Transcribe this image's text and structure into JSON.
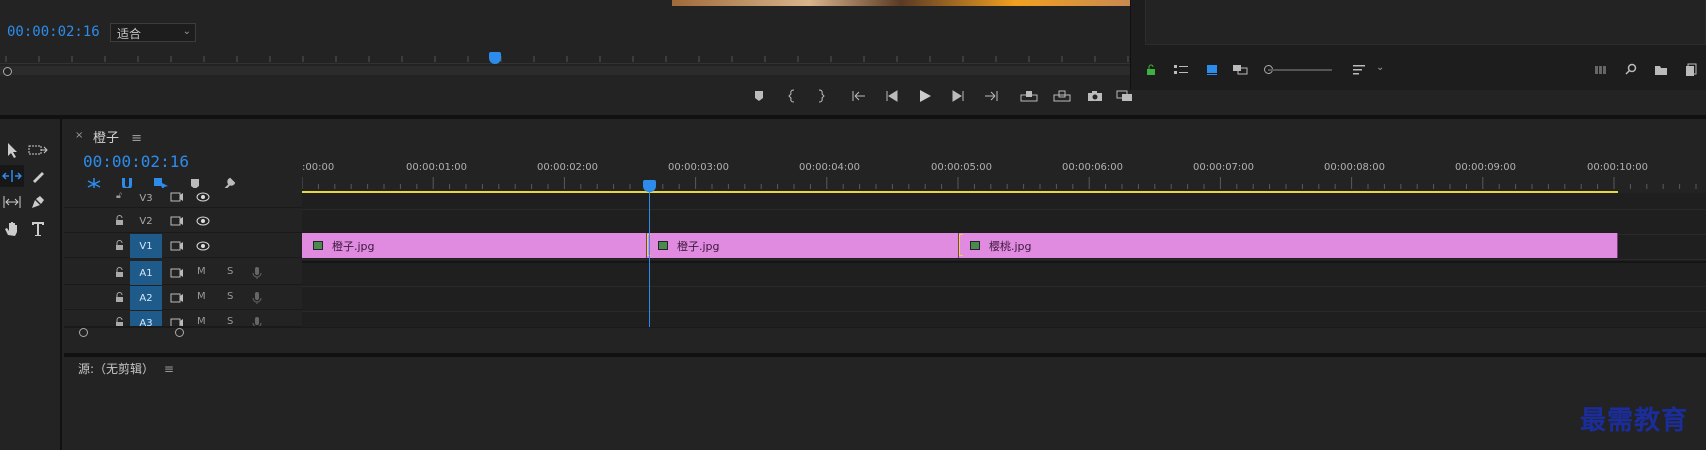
{
  "program_monitor": {
    "timecode": "00:00:02:16",
    "fit_select": "适合"
  },
  "timeline": {
    "tab_name": "橙子",
    "tab_menu_icon": "≡",
    "timecode": "00:00:02:16",
    "ruler_labels": [
      ":00:00",
      "00:00:01:00",
      "00:00:02:00",
      "00:00:03:00",
      "00:00:04:00",
      "00:00:05:00",
      "00:00:06:00",
      "00:00:07:00",
      "00:00:08:00",
      "00:00:09:00",
      "00:00:10:00"
    ],
    "video_tracks": [
      {
        "name": "V3",
        "target": false
      },
      {
        "name": "V2",
        "target": false
      },
      {
        "name": "V1",
        "target": true
      }
    ],
    "audio_tracks": [
      {
        "name": "A1",
        "m": "M",
        "s": "S"
      },
      {
        "name": "A2",
        "m": "M",
        "s": "S"
      },
      {
        "name": "A3",
        "m": "M",
        "s": "S"
      }
    ],
    "clips": [
      {
        "label": "橙子.jpg"
      },
      {
        "label": "橙子.jpg"
      },
      {
        "label": "樱桃.jpg"
      }
    ]
  },
  "source_panel": {
    "title": "源:（无剪辑）",
    "menu_icon": "≡"
  },
  "watermark": "最需教育",
  "colors": {
    "accent": "#2d8ceb",
    "clip": "#e08ae0",
    "work_area": "#e8d63a",
    "target_track": "#1e5a8a"
  }
}
